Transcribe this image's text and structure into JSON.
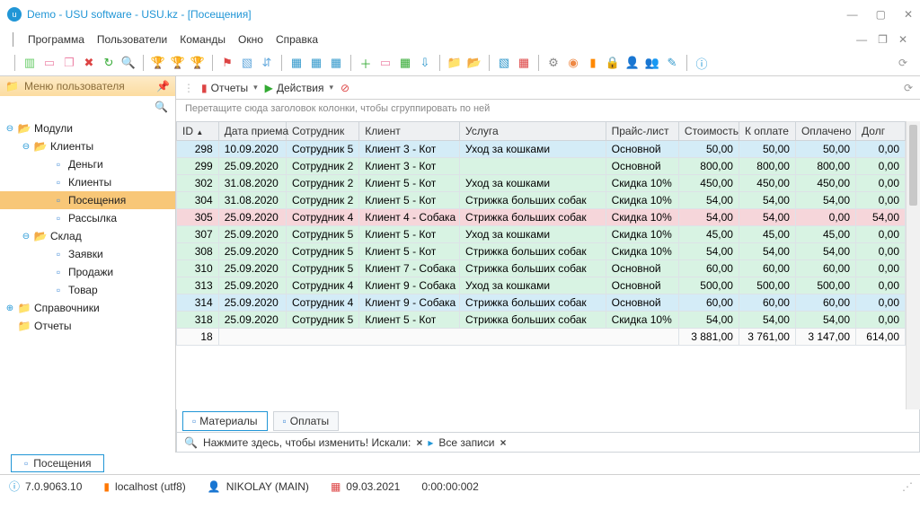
{
  "title": "Demo - USU software - USU.kz - [Посещения]",
  "menu": {
    "program": "Программа",
    "users": "Пользователи",
    "commands": "Команды",
    "window": "Окно",
    "help": "Справка"
  },
  "leftpanel": {
    "header": "Меню пользователя",
    "tree": {
      "modules": "Модули",
      "clients": "Клиенты",
      "money": "Деньги",
      "clients2": "Клиенты",
      "visits": "Посещения",
      "mailing": "Рассылка",
      "warehouse": "Склад",
      "requests": "Заявки",
      "sales": "Продажи",
      "goods": "Товар",
      "refs": "Справочники",
      "reports": "Отчеты"
    }
  },
  "righttb": {
    "reports": "Отчеты",
    "actions": "Действия"
  },
  "grouphint": "Перетащите сюда заголовок колонки, чтобы сгруппировать по ней",
  "cols": {
    "id": "ID",
    "date": "Дата приема",
    "emp": "Сотрудник",
    "client": "Клиент",
    "service": "Услуга",
    "price": "Прайс-лист",
    "cost": "Стоимость",
    "topay": "К оплате",
    "paid": "Оплачено",
    "debt": "Долг"
  },
  "rows": [
    {
      "cls": "r-blue",
      "id": "298",
      "date": "10.09.2020",
      "emp": "Сотрудник 5",
      "client": "Клиент 3 - Кот",
      "service": "Уход за кошками",
      "price": "Основной",
      "cost": "50,00",
      "topay": "50,00",
      "paid": "50,00",
      "debt": "0,00"
    },
    {
      "cls": "r-green",
      "id": "299",
      "date": "25.09.2020",
      "emp": "Сотрудник 2",
      "client": "Клиент 3 - Кот",
      "service": "",
      "price": "Основной",
      "cost": "800,00",
      "topay": "800,00",
      "paid": "800,00",
      "debt": "0,00"
    },
    {
      "cls": "r-green",
      "id": "302",
      "date": "31.08.2020",
      "emp": "Сотрудник 2",
      "client": "Клиент 5 - Кот",
      "service": "Уход за кошками",
      "price": "Скидка 10%",
      "cost": "450,00",
      "topay": "450,00",
      "paid": "450,00",
      "debt": "0,00"
    },
    {
      "cls": "r-green",
      "id": "304",
      "date": "31.08.2020",
      "emp": "Сотрудник 2",
      "client": "Клиент 5 - Кот",
      "service": "Стрижка больших собак",
      "price": "Скидка 10%",
      "cost": "54,00",
      "topay": "54,00",
      "paid": "54,00",
      "debt": "0,00"
    },
    {
      "cls": "r-pink",
      "id": "305",
      "date": "25.09.2020",
      "emp": "Сотрудник 4",
      "client": "Клиент 4 - Собака",
      "service": "Стрижка больших собак",
      "price": "Скидка 10%",
      "cost": "54,00",
      "topay": "54,00",
      "paid": "0,00",
      "debt": "54,00"
    },
    {
      "cls": "r-green",
      "id": "307",
      "date": "25.09.2020",
      "emp": "Сотрудник 5",
      "client": "Клиент 5 - Кот",
      "service": "Уход за кошками",
      "price": "Скидка 10%",
      "cost": "45,00",
      "topay": "45,00",
      "paid": "45,00",
      "debt": "0,00"
    },
    {
      "cls": "r-green",
      "id": "308",
      "date": "25.09.2020",
      "emp": "Сотрудник 5",
      "client": "Клиент 5 - Кот",
      "service": "Стрижка больших собак",
      "price": "Скидка 10%",
      "cost": "54,00",
      "topay": "54,00",
      "paid": "54,00",
      "debt": "0,00"
    },
    {
      "cls": "r-green",
      "id": "310",
      "date": "25.09.2020",
      "emp": "Сотрудник 5",
      "client": "Клиент 7 - Собака",
      "service": "Стрижка больших собак",
      "price": "Основной",
      "cost": "60,00",
      "topay": "60,00",
      "paid": "60,00",
      "debt": "0,00"
    },
    {
      "cls": "r-green",
      "id": "313",
      "date": "25.09.2020",
      "emp": "Сотрудник 4",
      "client": "Клиент 9 - Собака",
      "service": "Уход за кошками",
      "price": "Основной",
      "cost": "500,00",
      "topay": "500,00",
      "paid": "500,00",
      "debt": "0,00"
    },
    {
      "cls": "r-blue",
      "id": "314",
      "date": "25.09.2020",
      "emp": "Сотрудник 4",
      "client": "Клиент 9 - Собака",
      "service": "Стрижка больших собак",
      "price": "Основной",
      "cost": "60,00",
      "topay": "60,00",
      "paid": "60,00",
      "debt": "0,00"
    },
    {
      "cls": "r-green",
      "id": "318",
      "date": "25.09.2020",
      "emp": "Сотрудник 5",
      "client": "Клиент 5 - Кот",
      "service": "Стрижка больших собак",
      "price": "Скидка 10%",
      "cost": "54,00",
      "topay": "54,00",
      "paid": "54,00",
      "debt": "0,00"
    }
  ],
  "footer": {
    "count": "18",
    "cost": "3 881,00",
    "topay": "3 761,00",
    "paid": "3 147,00",
    "debt": "614,00"
  },
  "tabs": {
    "materials": "Материалы",
    "payments": "Оплаты"
  },
  "filter": {
    "hint": "Нажмите здесь, чтобы изменить! Искали:",
    "all": "Все записи"
  },
  "doctab": "Посещения",
  "status": {
    "ver": "7.0.9063.10",
    "host": "localhost (utf8)",
    "user": "NIKOLAY (MAIN)",
    "date": "09.03.2021",
    "time": "0:00:00:002"
  }
}
